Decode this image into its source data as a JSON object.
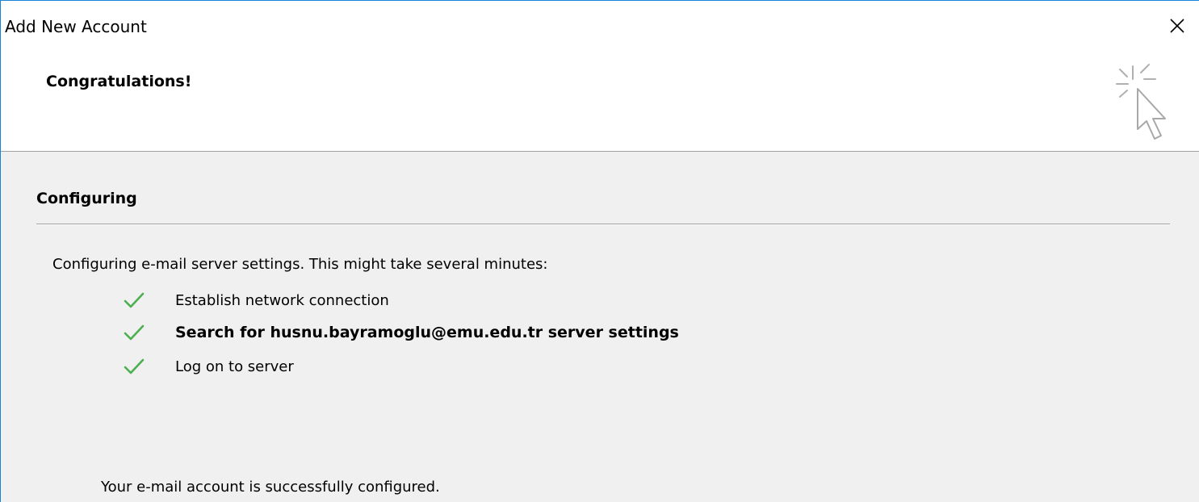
{
  "window": {
    "title": "Add New Account",
    "close_icon": "close-icon"
  },
  "header": {
    "title": "Congratulations!",
    "icon": "wizard-sparkle-cursor-icon"
  },
  "section": {
    "title": "Configuring",
    "intro": "Configuring e-mail server settings. This might take several minutes:"
  },
  "steps": [
    {
      "label": "Establish network connection",
      "status": "done",
      "icon": "check-icon"
    },
    {
      "label": "Search for husnu.bayramoglu@emu.edu.tr server settings",
      "status": "done",
      "icon": "check-icon"
    },
    {
      "label": "Log on to server",
      "status": "done",
      "icon": "check-icon"
    }
  ],
  "result": "Your e-mail account is successfully configured.",
  "colors": {
    "window_border": "#1883d7",
    "check": "#4caf50",
    "background": "#f0f0f0"
  }
}
